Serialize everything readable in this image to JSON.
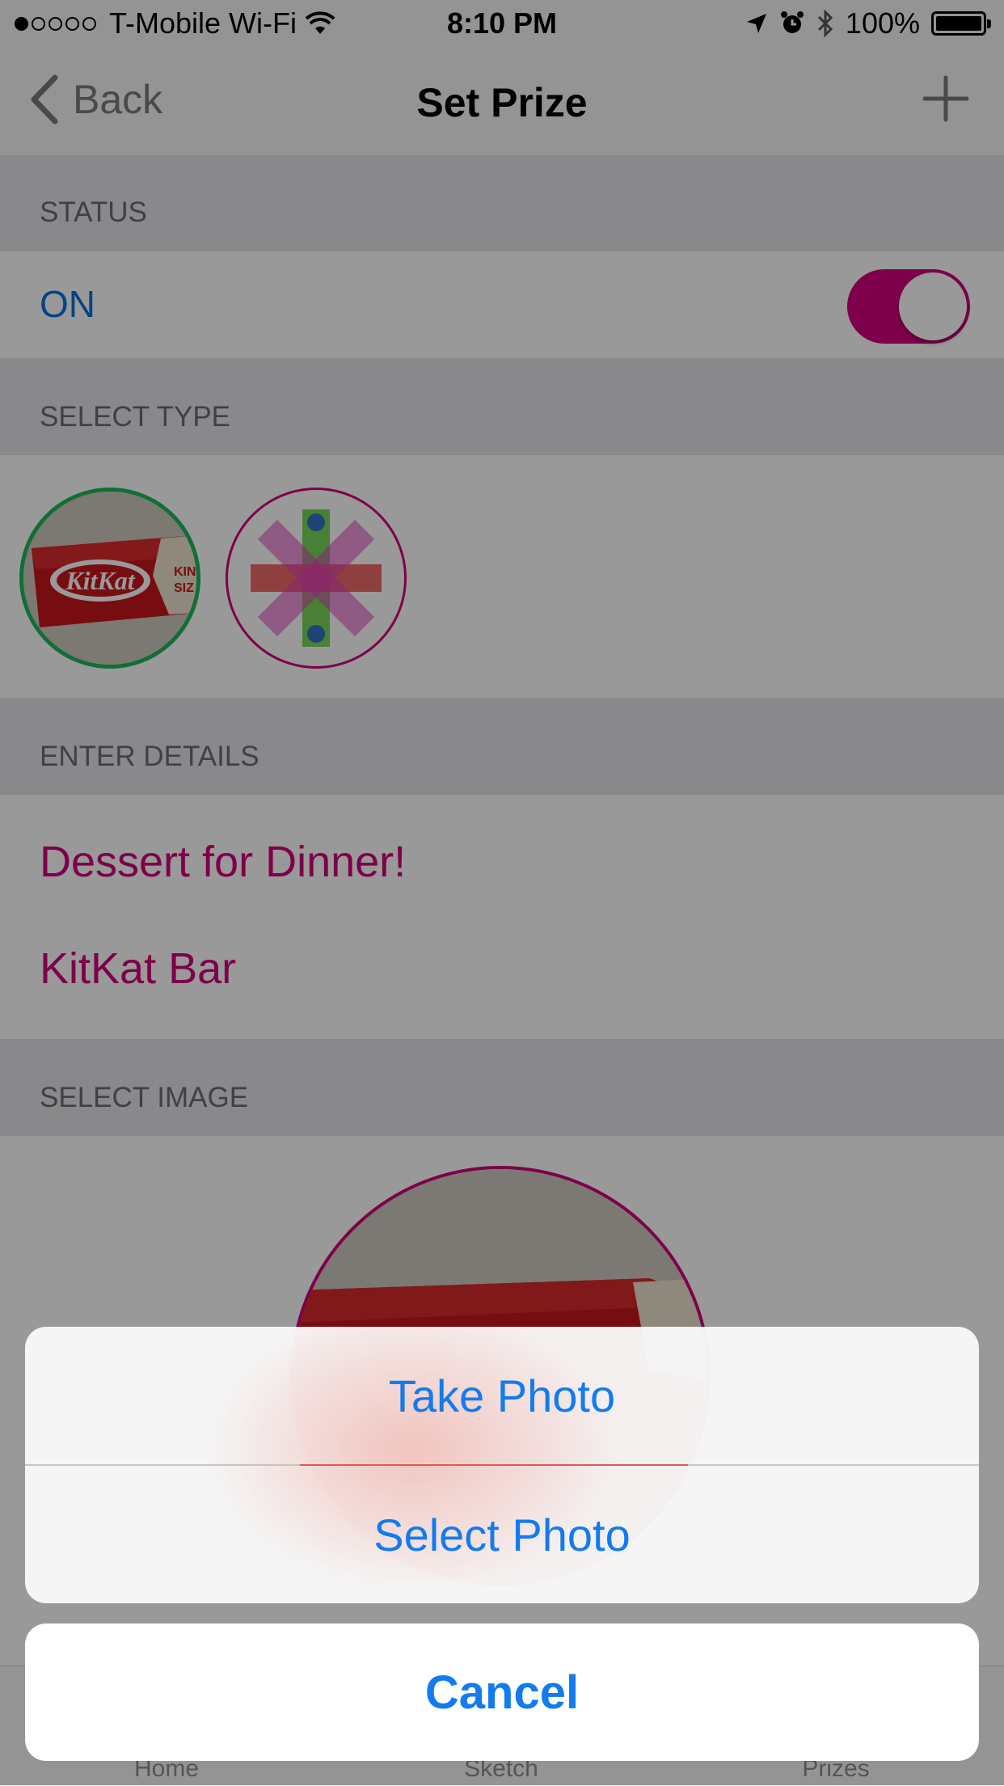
{
  "status_bar": {
    "carrier": "T-Mobile Wi-Fi",
    "time": "8:10 PM",
    "battery": "100%"
  },
  "nav": {
    "back_label": "Back",
    "title": "Set Prize"
  },
  "sections": {
    "status": "STATUS",
    "select_type": "SELECT TYPE",
    "enter_details": "ENTER DETAILS",
    "select_image": "SELECT IMAGE"
  },
  "status_row": {
    "label": "ON",
    "toggle_on": true
  },
  "types": [
    {
      "name": "candy-bar",
      "selected": true
    },
    {
      "name": "sticker-star",
      "selected": false
    }
  ],
  "details": {
    "prize_name": "Dessert for Dinner!",
    "prize_item": "KitKat Bar"
  },
  "tabs": [
    "Home",
    "Sketch",
    "Prizes"
  ],
  "action_sheet": {
    "take_photo": "Take Photo",
    "select_photo": "Select Photo",
    "cancel": "Cancel"
  },
  "colors": {
    "accent": "#d2007c",
    "ios_blue": "#127bf0",
    "on_label": "#0d6fdc",
    "selected_ring": "#1db85a"
  }
}
